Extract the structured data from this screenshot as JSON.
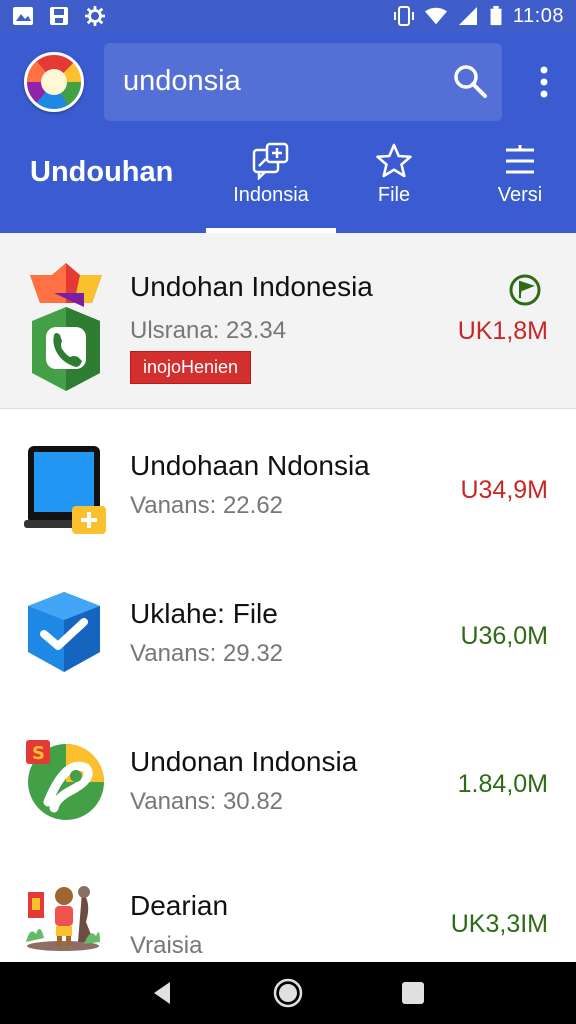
{
  "status_bar": {
    "time": "11:08",
    "left_icons": [
      "image-icon",
      "save-icon",
      "settings-icon"
    ],
    "right_icons": [
      "vibrate-icon",
      "wifi-icon",
      "signal-icon",
      "battery-icon"
    ]
  },
  "header": {
    "search_value": "undonsia",
    "section_title": "Undouhan",
    "tabs": [
      {
        "label": "Indonsia",
        "icon": "chat-add-icon",
        "active": true
      },
      {
        "label": "File",
        "icon": "star-icon",
        "active": false
      },
      {
        "label": "Versi",
        "icon": "menu-icon",
        "active": false
      }
    ]
  },
  "items": [
    {
      "title": "Undohan Indonesia",
      "subtitle": "Ulsrana: 23.34",
      "badge": "inojoHenien",
      "size": "UK1,8M",
      "size_color": "#c62828",
      "icon": "phone-app-icon",
      "flag": "flag-icon"
    },
    {
      "title": "Undohaan Ndonsia",
      "subtitle": "Vanans: 22.62",
      "size": "U34,9M",
      "size_color": "#c62828",
      "icon": "tablet-app-icon"
    },
    {
      "title": "Uklahe: File",
      "subtitle": "Vanans: 29.32",
      "size": "U36,0M",
      "size_color": "#2e6b15",
      "icon": "check-box-icon"
    },
    {
      "title": "Undonan Indonsia",
      "subtitle": "Vanans: 30.82",
      "size": "1.84,0M",
      "size_color": "#2e6b15",
      "icon": "green-app-icon"
    },
    {
      "title": "Dearian",
      "subtitle": "Vraisia",
      "size": "UK3,3IM",
      "size_color": "#2e6b15",
      "icon": "people-app-icon"
    }
  ],
  "colors": {
    "app_bar": "#3b5bd1",
    "status_bar": "#3f5ec9",
    "badge": "#d32f2f"
  },
  "nav": [
    "back-icon",
    "home-icon",
    "recents-icon"
  ]
}
